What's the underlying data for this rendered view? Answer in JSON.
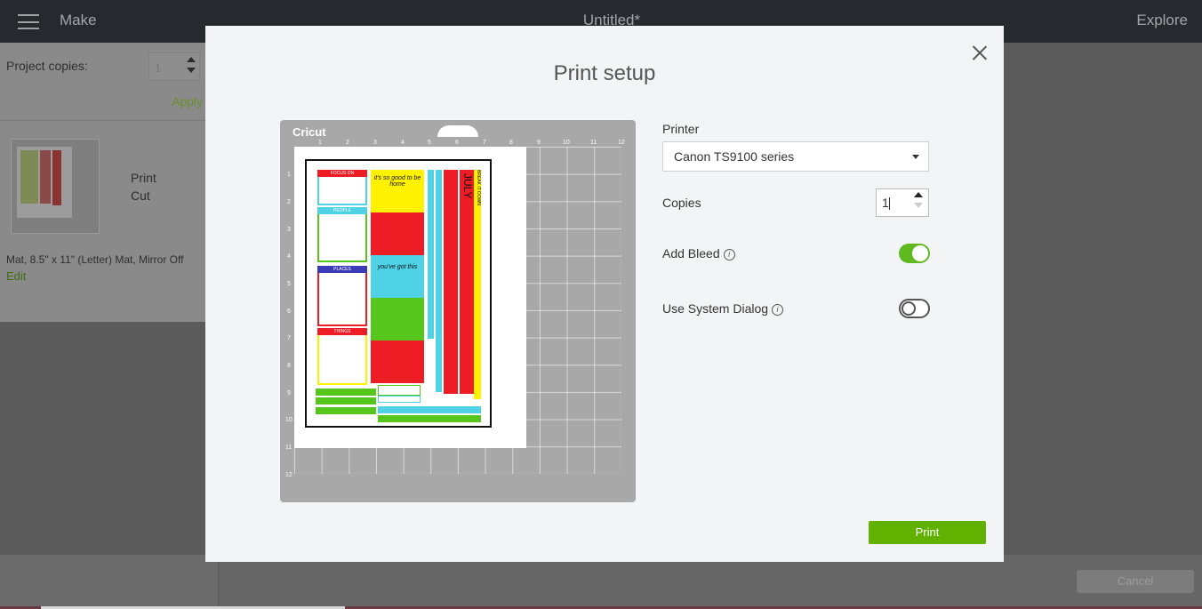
{
  "topbar": {
    "left_label": "Make",
    "title": "Untitled*",
    "right_label": "Explore"
  },
  "left_panel": {
    "project_copies_label": "Project copies:",
    "project_copies_value": "1",
    "apply_label": "Apply",
    "mat_labels": [
      "Print",
      "Cut"
    ],
    "mat_info": "Mat, 8.5\" x 11\" (Letter) Mat, Mirror Off",
    "edit_label": "Edit"
  },
  "dialog": {
    "title": "Print setup",
    "mat_brand": "Cricut",
    "ruler_top": [
      "1",
      "2",
      "3",
      "4",
      "5",
      "6",
      "7",
      "8",
      "9",
      "10",
      "11",
      "12"
    ],
    "ruler_left": [
      "1",
      "2",
      "3",
      "4",
      "5",
      "6",
      "7",
      "8",
      "9",
      "10",
      "11",
      "12"
    ],
    "art_labels": {
      "focus_on": "FOCUS ON",
      "people": "PEOPLE",
      "places": "PLACES",
      "things": "THINGS",
      "quote1": "it's so good to be home",
      "quote2": "you've got this",
      "month": "JULY",
      "banner": "BREAK IT DOWN"
    },
    "printer_label": "Printer",
    "printer_value": "Canon TS9100 series",
    "copies_label": "Copies",
    "copies_value": "1",
    "add_bleed_label": "Add Bleed",
    "add_bleed_on": true,
    "system_dialog_label": "Use System Dialog",
    "system_dialog_on": false,
    "print_button": "Print",
    "info_icon": "i"
  },
  "bottombar": {
    "cancel_label": "Cancel"
  },
  "colors": {
    "accent": "#61b921",
    "red": "#ee1c25",
    "yellow": "#fff200",
    "cyan": "#4fd1e6",
    "green": "#56c61c"
  }
}
